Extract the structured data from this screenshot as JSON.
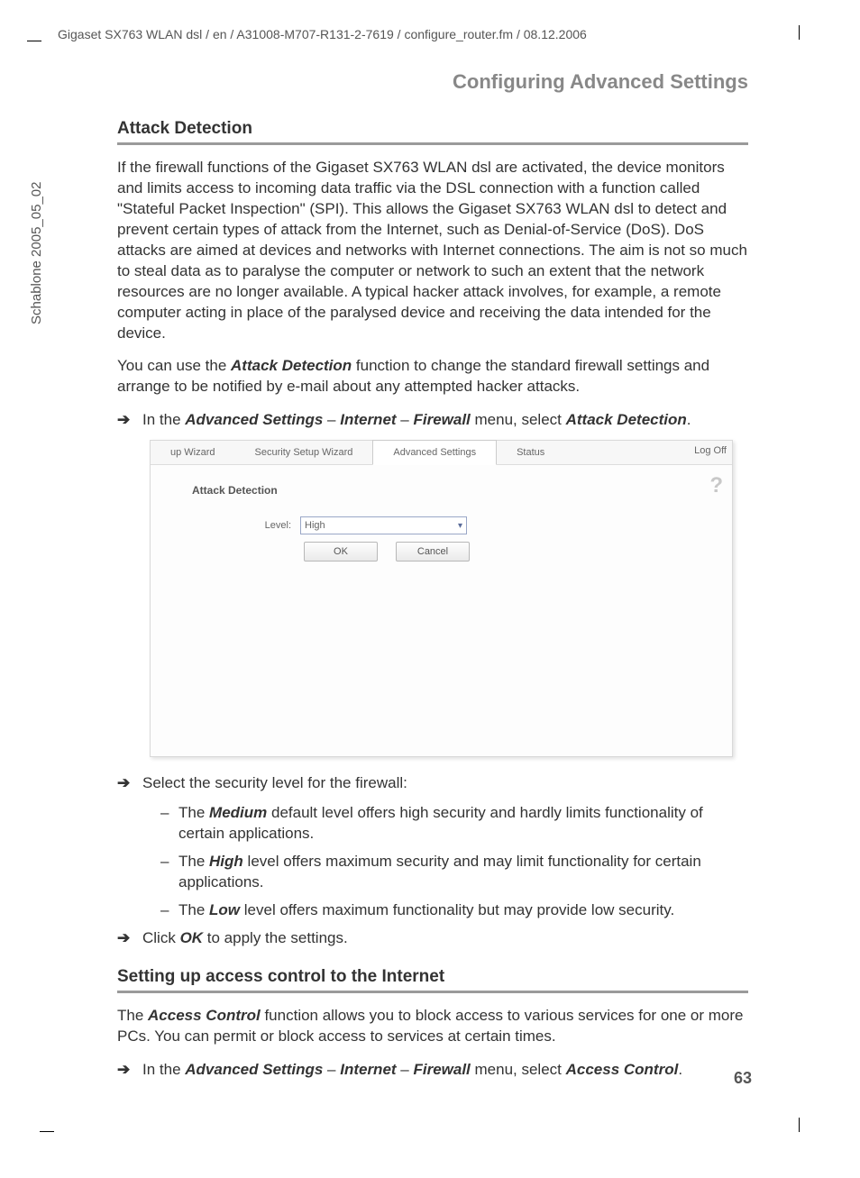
{
  "crop": true,
  "header_path": "Gigaset SX763 WLAN dsl / en / A31008-M707-R131-2-7619 / configure_router.fm / 08.12.2006",
  "side_text": "Schablone 2005_05_02",
  "breadcrumb": "Configuring Advanced Settings",
  "section1_title": "Attack Detection",
  "para1": "If the firewall functions of the Gigaset SX763 WLAN dsl are activated, the device monitors and limits access to incoming data traffic via the DSL connection with a function called \"Stateful Packet Inspection\" (SPI). This allows the Gigaset SX763 WLAN dsl to detect and prevent certain types of attack from the Internet, such as Denial-of-Service (DoS). DoS attacks are aimed at devices and networks with Internet connections. The aim is not so much to steal data as to paralyse the computer or network to such an extent that the network resources are no longer available. A typical hacker attack involves, for example, a remote computer acting in place of the paralysed device and receiving the data intended for the device.",
  "para2_pre": "You can use the ",
  "para2_bold": "Attack Detection",
  "para2_post": " function to change the standard firewall settings and arrange to be notified by e-mail about any attempted hacker attacks.",
  "nav1": {
    "pre": "In the ",
    "b1": "Advanced Settings",
    "sep": " – ",
    "b2": "Internet",
    "b3": "Firewall",
    "mid": " menu, select ",
    "b4": "Attack Detection",
    "end": "."
  },
  "ui": {
    "tabs": [
      "up Wizard",
      "Security Setup Wizard",
      "Advanced Settings",
      "Status"
    ],
    "active_tab_index": 2,
    "logoff": "Log Off",
    "title": "Attack Detection",
    "help": "?",
    "level_label": "Level:",
    "level_value": "High",
    "ok": "OK",
    "cancel": "Cancel"
  },
  "step_select": "Select the security level for the firewall:",
  "levels": {
    "medium_pre": "The ",
    "medium_b": "Medium",
    "medium_post": " default level offers high security and hardly limits functionality of certain applications.",
    "high_pre": "The ",
    "high_b": "High",
    "high_post": " level offers maximum security and may limit functionality for certain applications.",
    "low_pre": "The ",
    "low_b": "Low",
    "low_post": " level offers maximum functionality but may provide low security."
  },
  "step_ok_pre": "Click ",
  "step_ok_b": "OK",
  "step_ok_post": " to apply the settings.",
  "section2_title": "Setting up access control to the Internet",
  "para3_pre": "The ",
  "para3_b": "Access Control",
  "para3_post": " function allows you to block access to various services for one or more PCs. You can permit or block access to services at certain times.",
  "nav2": {
    "pre": "In the ",
    "b1": "Advanced Settings",
    "sep": " – ",
    "b2": "Internet",
    "b3": "Firewall",
    "mid": " menu, select ",
    "b4": "Access Control",
    "end": "."
  },
  "page_number": "63"
}
